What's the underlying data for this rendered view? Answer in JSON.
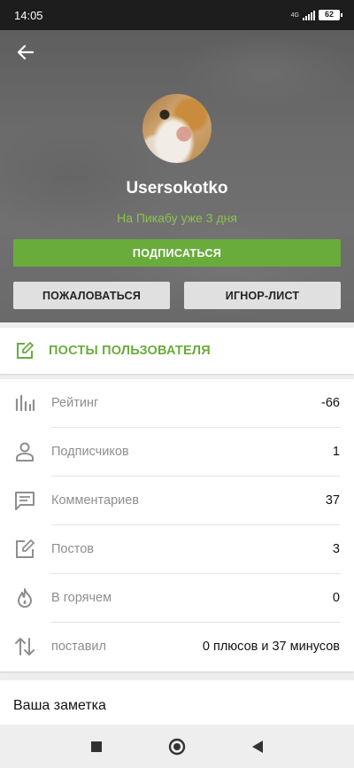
{
  "status_bar": {
    "time": "14:05",
    "network": "4G",
    "battery": "62"
  },
  "profile": {
    "username": "Usersokotko",
    "since": "На Пикабу уже 3 дня"
  },
  "buttons": {
    "subscribe": "ПОДПИСАТЬСЯ",
    "complain": "ПОЖАЛОВАТЬСЯ",
    "ignore_list": "ИГНОР-ЛИСТ"
  },
  "posts_link": {
    "label": "ПОСТЫ ПОЛЬЗОВАТЕЛЯ"
  },
  "stats": [
    {
      "icon": "rating-icon",
      "label": "Рейтинг",
      "value": "-66"
    },
    {
      "icon": "subscribers-icon",
      "label": "Подписчиков",
      "value": "1"
    },
    {
      "icon": "comments-icon",
      "label": "Комментариев",
      "value": "37"
    },
    {
      "icon": "posts-icon",
      "label": "Постов",
      "value": "3"
    },
    {
      "icon": "hot-icon",
      "label": "В горячем",
      "value": "0"
    },
    {
      "icon": "votes-icon",
      "label": "поставил",
      "value": "0 плюсов и 37 минусов"
    }
  ],
  "note": {
    "title": "Ваша заметка"
  },
  "colors": {
    "accent": "#69ac3c",
    "accent_text": "#8bc34a"
  }
}
